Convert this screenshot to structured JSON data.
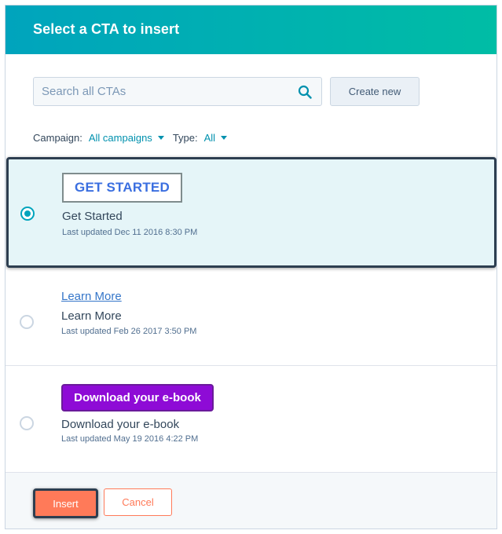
{
  "dialog": {
    "title": "Select a CTA to insert"
  },
  "search": {
    "placeholder": "Search all CTAs",
    "value": ""
  },
  "create_new_label": "Create new",
  "filters": {
    "campaign_label": "Campaign:",
    "campaign_value": "All campaigns",
    "type_label": "Type:",
    "type_value": "All"
  },
  "ctas": [
    {
      "preview_text": "GET STARTED",
      "name": "Get Started",
      "last_updated": "Last updated Dec 11 2016 8:30 PM",
      "selected": true
    },
    {
      "preview_text": "Learn More",
      "name": "Learn More",
      "last_updated": "Last updated Feb 26 2017 3:50 PM",
      "selected": false
    },
    {
      "preview_text": "Download your e-book",
      "name": "Download your e-book",
      "last_updated": "Last updated May 19 2016 4:22 PM",
      "selected": false
    }
  ],
  "footer": {
    "insert_label": "Insert",
    "cancel_label": "Cancel"
  },
  "colors": {
    "header_gradient_start": "#00a4bd",
    "header_gradient_end": "#00bda5",
    "accent_link": "#0091ae",
    "selected_row_bg": "#e5f5f8",
    "primary_button": "#ff7a59",
    "ebook_button": "#8e0bd6"
  }
}
